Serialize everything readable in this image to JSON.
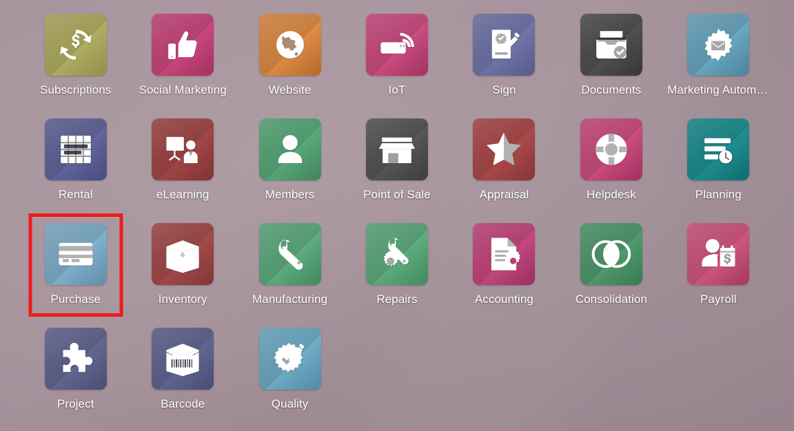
{
  "screen": {
    "name": "odoo-apps-drawer",
    "background_color": "#a38f98",
    "highlight_color": "#f01b1b",
    "label_color": "#ffffff"
  },
  "apps": [
    {
      "label": "Subscriptions",
      "icon": "subscriptions-icon",
      "color": "#b0ad60",
      "color_dark": "#9a9750"
    },
    {
      "label": "Social Marketing",
      "icon": "thumbs-up-icon",
      "color": "#c9447b",
      "color_dark": "#ab3566"
    },
    {
      "label": "Website",
      "icon": "globe-icon",
      "color": "#e08a43",
      "color_dark": "#c06f2f"
    },
    {
      "label": "IoT",
      "icon": "wifi-router-icon",
      "color": "#cc4a80",
      "color_dark": "#a93566"
    },
    {
      "label": "Sign",
      "icon": "signed-document-icon",
      "color": "#6f74a8",
      "color_dark": "#5c6092"
    },
    {
      "label": "Documents",
      "icon": "file-box-check-icon",
      "color": "#4d4d4d",
      "color_dark": "#3a3a3a"
    },
    {
      "label": "Marketing Automat…",
      "icon": "gear-envelope-icon",
      "color": "#68a6c0",
      "color_dark": "#4f8ca8"
    },
    {
      "label": "Rental",
      "icon": "gantt-table-icon",
      "color": "#60639b",
      "color_dark": "#4e5186"
    },
    {
      "label": "eLearning",
      "icon": "presenter-board-icon",
      "color": "#a14444",
      "color_dark": "#873636"
    },
    {
      "label": "Members",
      "icon": "person-icon",
      "color": "#57a878",
      "color_dark": "#458c62"
    },
    {
      "label": "Point of Sale",
      "icon": "storefront-icon",
      "color": "#545454",
      "color_dark": "#414141"
    },
    {
      "label": "Appraisal",
      "icon": "half-star-icon",
      "color": "#ab4747",
      "color_dark": "#8e3939"
    },
    {
      "label": "Helpdesk",
      "icon": "life-ring-icon",
      "color": "#cc4a7e",
      "color_dark": "#a93565"
    },
    {
      "label": "Planning",
      "icon": "bars-clock-icon",
      "color": "#1a8d90",
      "color_dark": "#127275"
    },
    {
      "label": "Purchase",
      "icon": "credit-card-icon",
      "color": "#7fb0cc",
      "color_dark": "#6596b4",
      "highlighted": true
    },
    {
      "label": "Inventory",
      "icon": "open-box-icon",
      "color": "#a34848",
      "color_dark": "#873a3a"
    },
    {
      "label": "Manufacturing",
      "icon": "wrench-icon",
      "color": "#5cab7d",
      "color_dark": "#489066"
    },
    {
      "label": "Repairs",
      "icon": "wrench-gear-icon",
      "color": "#5cab7d",
      "color_dark": "#489066"
    },
    {
      "label": "Accounting",
      "icon": "document-gear-icon",
      "color": "#c4457c",
      "color_dark": "#a33365"
    },
    {
      "label": "Consolidation",
      "icon": "venn-circles-icon",
      "color": "#4d9a6b",
      "color_dark": "#3c8157"
    },
    {
      "label": "Payroll",
      "icon": "person-money-icon",
      "color": "#d0537f",
      "color_dark": "#ad3d66"
    },
    {
      "label": "Project",
      "icon": "puzzle-piece-icon",
      "color": "#61658f",
      "color_dark": "#4f5379"
    },
    {
      "label": "Barcode",
      "icon": "box-barcode-icon",
      "color": "#5f6391",
      "color_dark": "#4d517b"
    },
    {
      "label": "Quality",
      "icon": "badge-pencil-icon",
      "color": "#6eacc7",
      "color_dark": "#5692ae"
    }
  ]
}
